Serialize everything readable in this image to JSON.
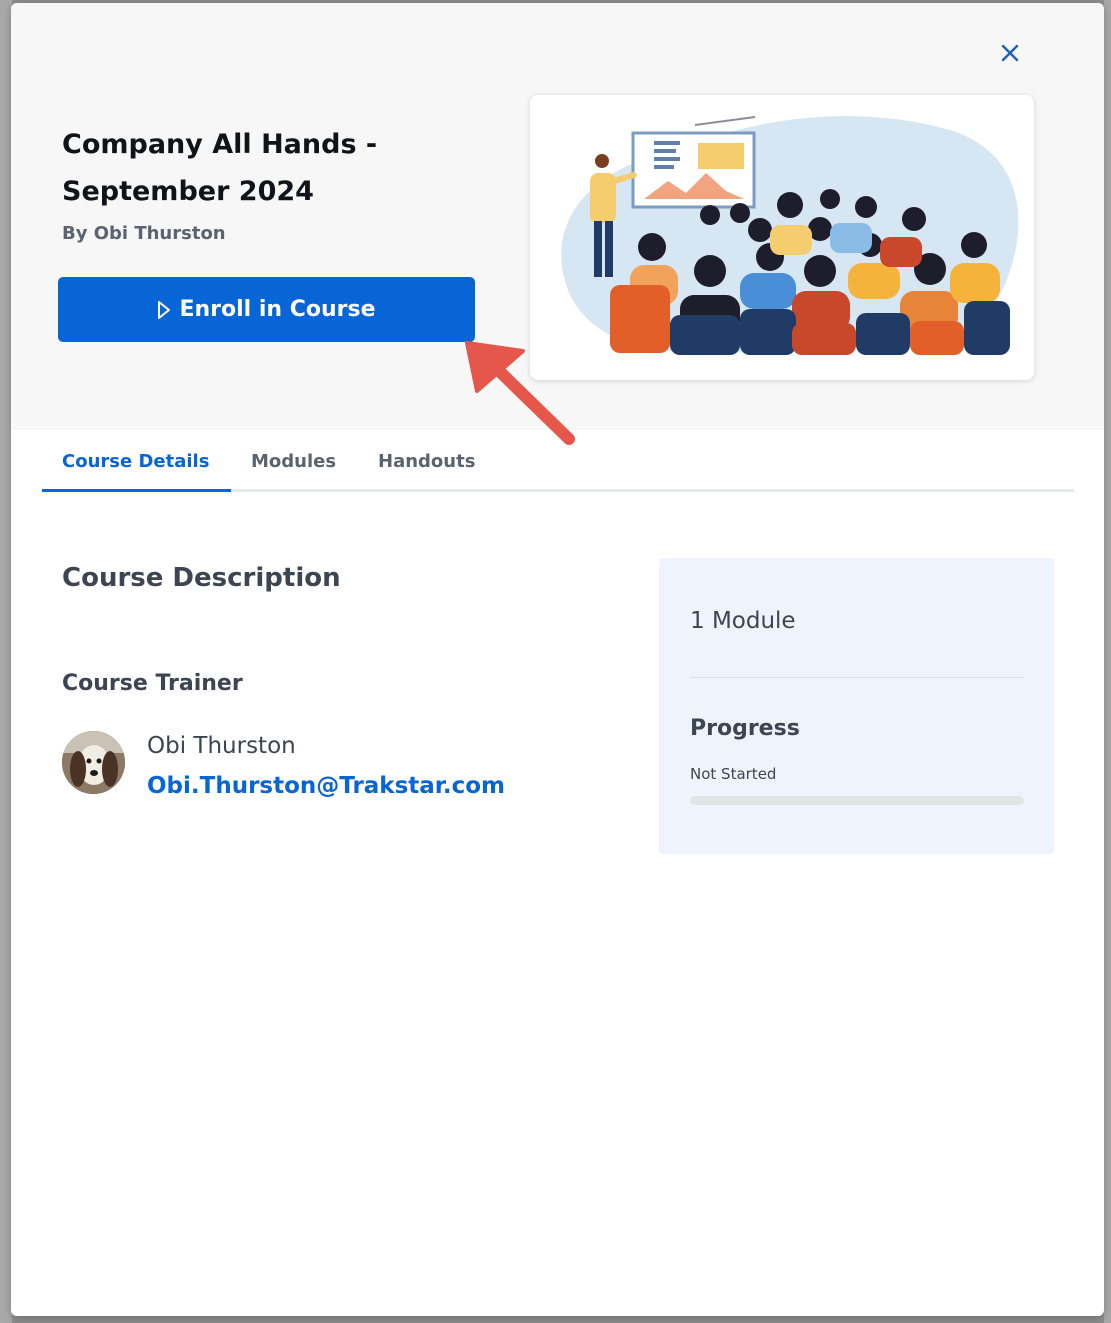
{
  "modal": {
    "close_label": "×",
    "course": {
      "title_line1": "Company All Hands -",
      "title_line2": "September 2024",
      "author": "By Obi Thurston",
      "enroll_label": "Enroll in Course"
    },
    "tabs": [
      {
        "label": "Course Details",
        "active": true
      },
      {
        "label": "Modules",
        "active": false
      },
      {
        "label": "Handouts",
        "active": false
      }
    ],
    "details": {
      "description_heading": "Course Description",
      "trainer_heading": "Course Trainer",
      "trainer_name": "Obi Thurston",
      "trainer_email": "Obi.Thurston@Trakstar.com"
    },
    "summary": {
      "module_count": "1 Module",
      "progress_heading": "Progress",
      "progress_status": "Not Started",
      "progress_fraction": 0
    }
  },
  "colors": {
    "accent": "#0765d6",
    "annotation_arrow": "#e5574a",
    "summary_bg": "#eff4fc"
  },
  "icons": {
    "close": "close-icon",
    "enroll": "play-outline-icon",
    "illustration": "presentation-audience-illustration",
    "annotation": "red-pointer-arrow"
  }
}
